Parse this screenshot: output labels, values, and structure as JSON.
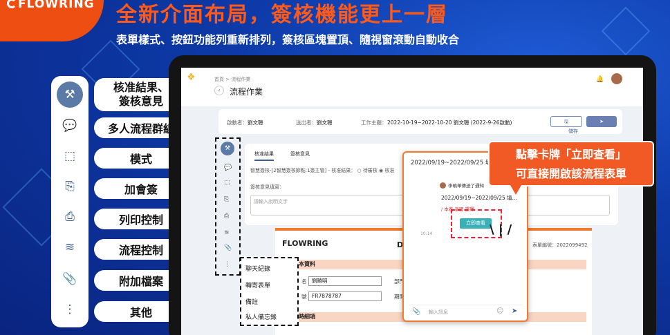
{
  "brand": {
    "logo_text": "FLOWRING",
    "accent": "#ee4e12"
  },
  "heading": "全新介面布局，簽核機能更上一層",
  "subheading": "表單樣式、按鈕功能列重新排列，簽核區塊置頂、隨視窗滾動自動收合",
  "rail": {
    "icons": [
      "approve-hammer-icon",
      "chat-icon",
      "template-icon",
      "add-sign-icon",
      "print-icon",
      "flow-icon",
      "attachment-icon",
      "more-icon"
    ],
    "labels": {
      "approve_1": "核准結果、",
      "approve_2": "簽核意見",
      "group": "多人流程群組",
      "template": "模式",
      "add_sign": "加會簽",
      "print": "列印控制",
      "flow": "流程控制",
      "attach": "附加檔案",
      "other": "其他"
    }
  },
  "app": {
    "breadcrumb": "首頁 > 流程作業",
    "page_title": "流程作業",
    "info": {
      "starter_label": "啟動者：",
      "starter": "劉文聰",
      "sender_label": "送出者：",
      "sender": "劉文聰",
      "subject_label": "工作主題：",
      "subject": "2022-10-19~2022-10-20 劉文聰 (2022-9-26啟動)",
      "save": "儲存",
      "send": "送出"
    },
    "tabs": {
      "result": "核准結果",
      "opinion": "簽核意見"
    },
    "approval_line": "智慧簽核-[2智慧簽核節點:1簽主管] - 核准結果：",
    "options": {
      "pending": "待審核",
      "approve": "核准"
    },
    "opinion_label": "簽核意見填寫：",
    "opinion_placeholder": "請輸入說明文字",
    "doc": {
      "logo": "FLOWRING",
      "name": "DO",
      "number": "表單編號：2022099492",
      "section_basic": "本資料",
      "section_time": "時細項",
      "name_label": "名",
      "name_value": "劉曉明",
      "id_label": "號",
      "id_value": "FR7878787",
      "dept_label": "部門",
      "period_label": "期間"
    },
    "menu": [
      "聊天紀錄",
      "轉寄表單",
      "備註",
      "私人備忘錄"
    ]
  },
  "chat": {
    "header": "2022/09/19~2022/09/25 填...",
    "from": "李曉華傳送了通知",
    "message": "2022/09/19~2022/09/25 填...",
    "sub": "/ 本表 基礎 選擇",
    "view_button": "立即查看",
    "time": "10:14",
    "input_placeholder": "輸入訊息"
  },
  "callout": {
    "line1": "點擊卡牌「立即查看」",
    "line2": "可直接開啟該流程表單"
  }
}
